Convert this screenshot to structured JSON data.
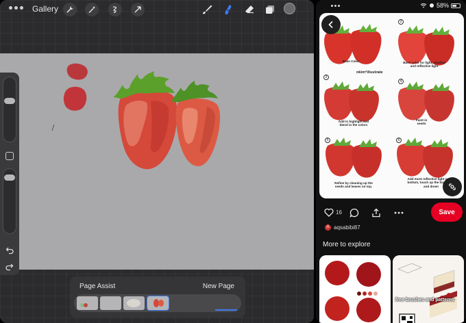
{
  "procreate": {
    "gallery_label": "Gallery",
    "page_assist": {
      "title": "Page Assist",
      "new_page_label": "New Page",
      "thumbnails": [
        "page-1",
        "page-2",
        "page-3",
        "page-4"
      ],
      "selected_index": 3
    }
  },
  "status_bar": {
    "battery_text": "58%"
  },
  "pin": {
    "watermark": "nkim°illustrate",
    "steps": [
      {
        "num": "1",
        "caption": "Base Color"
      },
      {
        "num": "2",
        "caption": "Base color for light, shadow and reflective light"
      },
      {
        "num": "3",
        "caption": "Add in highlight and blend in the colors"
      },
      {
        "num": "4",
        "caption": "Paint in seeds"
      },
      {
        "num": "5",
        "caption": "Refine by cleaning up the seeds and leaves on top."
      },
      {
        "num": "6",
        "caption": "Add more reflective light on the bottom, touch up the highlights and done!"
      }
    ],
    "like_count": "16",
    "save_label": "Save",
    "username": "aqsabibi87",
    "avatar_letter": "A"
  },
  "more_to_explore": {
    "title": "More to explore",
    "card2_text": "free brushes and patterns"
  },
  "colors": {
    "save_red": "#e60023",
    "procreate_accent": "#3d7df5",
    "canvas_gray": "#a9a9ab"
  }
}
